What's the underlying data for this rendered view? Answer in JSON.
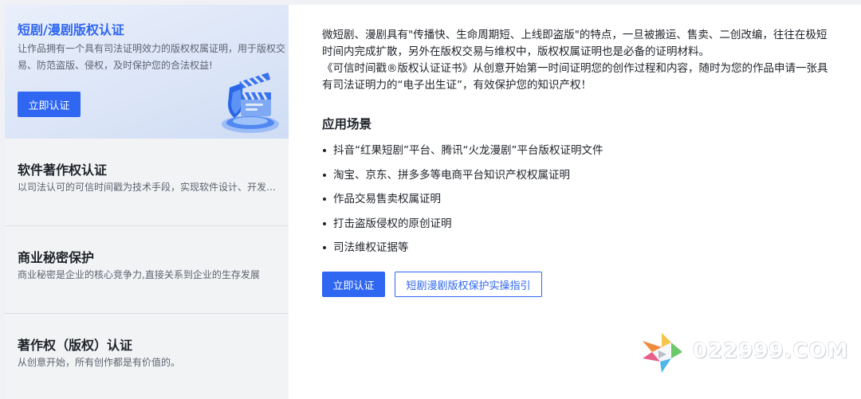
{
  "sidebar": {
    "cards": [
      {
        "title": "短剧/漫剧版权认证",
        "desc": "让作品拥有一个具有司法证明效力的版权权属证明，用于版权交易、防范盗版、侵权，及时保护您的合法权益!",
        "button": "立即认证"
      },
      {
        "title": "软件著作权认证",
        "desc": "以司法认可的可信时间戳为技术手段，实现软件设计、开发过程的证明"
      },
      {
        "title": "商业秘密保护",
        "desc": "商业秘密是企业的核心竞争力,直接关系到企业的生存发展"
      },
      {
        "title": "著作权（版权）认证",
        "desc": "从创意开始，所有创作都是有价值的。"
      }
    ]
  },
  "main": {
    "intro_1": "微短剧、漫剧具有\"传播快、生命周期短、上线即盗版\"的特点，一旦被搬运、售卖、二创改编，往往在极短时间内完成扩散，另外在版权交易与维权中，版权权属证明也是必备的证明材料。",
    "intro_2": "《可信时间戳®版权认证证书》从创意开始第一时间证明您的创作过程和内容，随时为您的作品申请一张具有司法证明力的“电子出生证”，有效保护您的知识产权！",
    "section_title": "应用场景",
    "scenes": [
      "抖音“红果短剧”平台、腾讯“火龙漫剧”平台版权证明文件",
      "淘宝、京东、拼多多等电商平台知识产权权属证明",
      "作品交易售卖权属证明",
      "打击盗版侵权的原创证明",
      "司法维权证据等"
    ],
    "primary_button": "立即认证",
    "secondary_button": "短剧漫剧版权保护实操指引"
  },
  "watermark": {
    "text": "022999.COM"
  },
  "colors": {
    "accent": "#2f66f2",
    "background": "#f0f1f4",
    "card_active": "#dbe5f7"
  }
}
